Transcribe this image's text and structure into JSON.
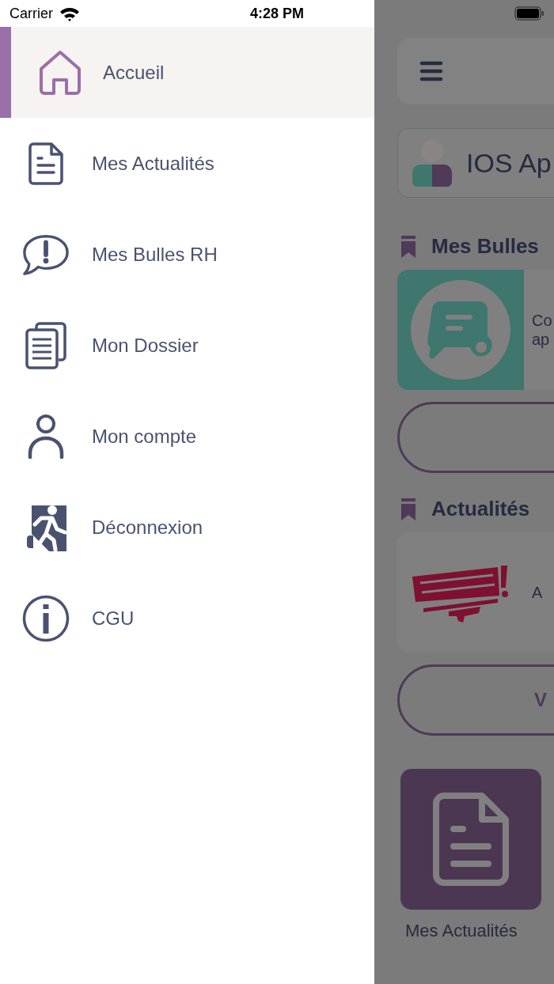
{
  "status_bar": {
    "carrier": "Carrier",
    "time": "4:28 PM"
  },
  "drawer": {
    "items": [
      {
        "label": "Accueil",
        "kind": "home",
        "selected": true
      },
      {
        "label": "Mes Actualités",
        "kind": "document",
        "selected": false
      },
      {
        "label": "Mes Bulles RH",
        "kind": "alert",
        "selected": false
      },
      {
        "label": "Mon Dossier",
        "kind": "folder",
        "selected": false
      },
      {
        "label": "Mon compte",
        "kind": "account",
        "selected": false
      },
      {
        "label": "Déconnexion",
        "kind": "logout",
        "selected": false
      },
      {
        "label": "CGU",
        "kind": "info",
        "selected": false
      }
    ]
  },
  "background_screen": {
    "profile_name": "IOS Ap",
    "sections": [
      {
        "title": "Mes Bulles",
        "card": {
          "kind": "bubble",
          "text_lines": [
            "Co",
            "ap"
          ]
        }
      },
      {
        "title": "Actualités",
        "card": {
          "kind": "picture",
          "text_lines": [
            "A"
          ]
        },
        "button_label": "V"
      }
    ],
    "tile": {
      "label": "Mes Actualités"
    }
  }
}
